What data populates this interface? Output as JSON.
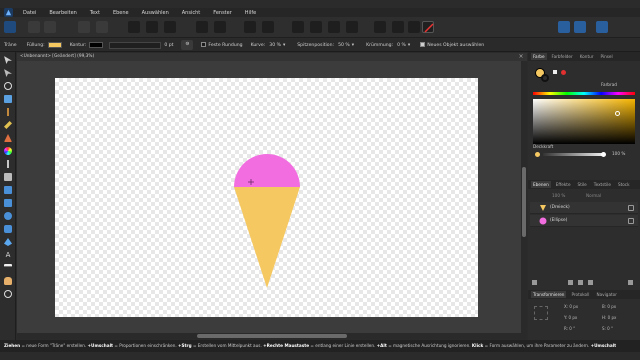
{
  "menubar": {
    "items": [
      "Datei",
      "Bearbeiten",
      "Text",
      "Ebene",
      "Auswählen",
      "Ansicht",
      "Fenster",
      "Hilfe"
    ]
  },
  "context": {
    "tool_name": "Träne",
    "fill_label": "Füllung:",
    "stroke_label": "Kontur:",
    "stroke_width": "0 pt",
    "fixed_rounding_label": "Feste Rundung",
    "curve_label": "Kurve:",
    "curve_value": "30 %",
    "tip_position_label": "Spitzenposition:",
    "tip_position_value": "50 %",
    "bend_label": "Krümmung:",
    "bend_value": "0 %",
    "select_new_object_label": "Neues Objekt auswählen",
    "fill_color": "#f5c862",
    "stroke_color": "#000000"
  },
  "document": {
    "tab_title": "<Unbenannt> [Geändert] (99,3%)"
  },
  "canvas_shapes": {
    "scoop_color": "#f26ee0",
    "cone_color": "#f5c862"
  },
  "color_panel": {
    "tabs": [
      "Farbe",
      "Farbfelder",
      "Kontur",
      "Pinsel"
    ],
    "mode": "Farbrad",
    "opacity_label": "Deckkraft",
    "opacity_value": "100 %"
  },
  "layers_panel": {
    "tabs": [
      "Ebenen",
      "Effekte",
      "Stile",
      "Textstile",
      "Stock"
    ],
    "opacity_value": "100 %",
    "blend_mode": "Normal",
    "layers": [
      {
        "name": "(Dreieck)",
        "color": "#f5c862"
      },
      {
        "name": "(Ellipse)",
        "color": "#f26ee0"
      }
    ]
  },
  "transform_panel": {
    "tabs": [
      "Transformieren",
      "Protokoll",
      "Navigator"
    ],
    "fields": [
      {
        "label": "X:",
        "value": "0 px"
      },
      {
        "label": "B:",
        "value": "0 px"
      },
      {
        "label": "Y:",
        "value": "0 px"
      },
      {
        "label": "H:",
        "value": "0 px"
      },
      {
        "label": "R:",
        "value": "0 °"
      },
      {
        "label": "S:",
        "value": "0 °"
      }
    ]
  },
  "status": {
    "p1_bold": "Ziehen",
    "p1": " = neue Form \"Träne\" erstellen. ",
    "p2_bold": "+Umschalt",
    "p2": " = Proportionen einschränken. ",
    "p3_bold": "+Strg",
    "p3": " = Erstellen vom Mittelpunkt aus. ",
    "p4_bold": "+Rechte Maustaste",
    "p4": " = entlang einer Linie erstellen. ",
    "p5_bold": "+Alt",
    "p5": " = magnetische Ausrichtung ignorieren. ",
    "p6_bold": "Klick",
    "p6": " = Form auswählen, um ihre Parameter zu ändern. ",
    "p7_bold": "+Umschalt"
  }
}
